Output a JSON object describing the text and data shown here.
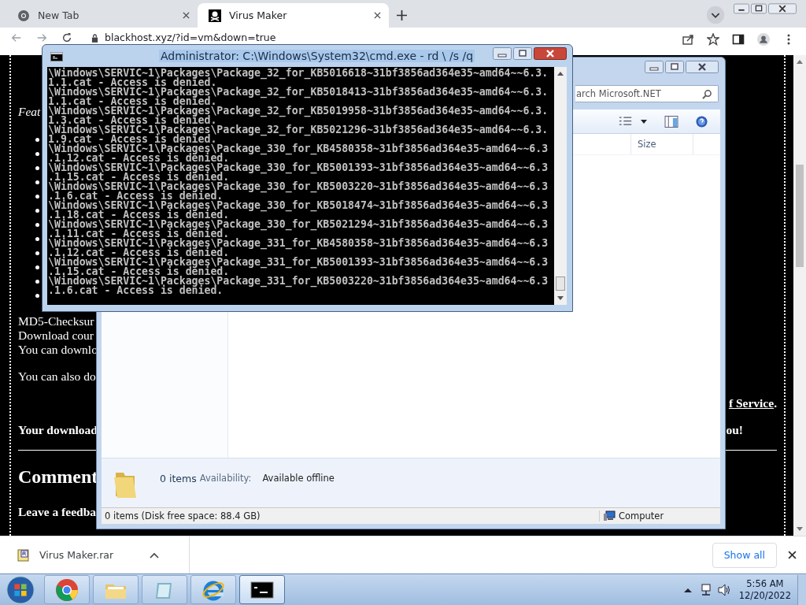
{
  "browser": {
    "tabs": [
      {
        "title": "New Tab",
        "kind": "chrome",
        "selected": false
      },
      {
        "title": "Virus Maker",
        "kind": "pirate",
        "selected": true
      }
    ],
    "address": "blackhost.xyz/?id=vm&down=true"
  },
  "page": {
    "feature_label": "Feat",
    "info_lines": [
      "MD5-Checksur",
      "Download cour",
      "You can downlo"
    ],
    "also_line": "You can also do",
    "terms_link": "f Service",
    "terms_end": ".",
    "download_note": "Your download",
    "download_note_end": "ou!",
    "comments_heading": "Comment",
    "feedback_label": "Leave a feedba"
  },
  "cmd": {
    "title": "Administrator: C:\\Windows\\System32\\cmd.exe - rd \\ /s /q",
    "lines": [
      "\\Windows\\SERVIC~1\\Packages\\Package_32_for_KB5016618~31bf3856ad364e35~amd64~~6.3.",
      "1.1.cat - Access is denied.",
      "\\Windows\\SERVIC~1\\Packages\\Package_32_for_KB5018413~31bf3856ad364e35~amd64~~6.3.",
      "1.1.cat - Access is denied.",
      "\\Windows\\SERVIC~1\\Packages\\Package_32_for_KB5019958~31bf3856ad364e35~amd64~~6.3.",
      "1.3.cat - Access is denied.",
      "\\Windows\\SERVIC~1\\Packages\\Package_32_for_KB5021296~31bf3856ad364e35~amd64~~6.3.",
      "1.9.cat - Access is denied.",
      "\\Windows\\SERVIC~1\\Packages\\Package_330_for_KB4580358~31bf3856ad364e35~amd64~~6.3",
      ".1.12.cat - Access is denied.",
      "\\Windows\\SERVIC~1\\Packages\\Package_330_for_KB5001393~31bf3856ad364e35~amd64~~6.3",
      ".1.15.cat - Access is denied.",
      "\\Windows\\SERVIC~1\\Packages\\Package_330_for_KB5003220~31bf3856ad364e35~amd64~~6.3",
      ".1.6.cat - Access is denied.",
      "\\Windows\\SERVIC~1\\Packages\\Package_330_for_KB5018474~31bf3856ad364e35~amd64~~6.3",
      ".1.18.cat - Access is denied.",
      "\\Windows\\SERVIC~1\\Packages\\Package_330_for_KB5021294~31bf3856ad364e35~amd64~~6.3",
      ".1.11.cat - Access is denied.",
      "\\Windows\\SERVIC~1\\Packages\\Package_331_for_KB4580358~31bf3856ad364e35~amd64~~6.3",
      ".1.12.cat - Access is denied.",
      "\\Windows\\SERVIC~1\\Packages\\Package_331_for_KB5001393~31bf3856ad364e35~amd64~~6.3",
      ".1.15.cat - Access is denied.",
      "\\Windows\\SERVIC~1\\Packages\\Package_331_for_KB5003220~31bf3856ad364e35~amd64~~6.3",
      ".1.6.cat - Access is denied."
    ]
  },
  "explorer": {
    "search": {
      "placeholder": "arch Microsoft.NET"
    },
    "columns": [
      "Size"
    ],
    "details": {
      "count": "0 items",
      "availability_label": "Availability:",
      "availability": "Available offline"
    },
    "status": {
      "items": "0 items (Disk free space: 88.4 GB)",
      "location": "Computer"
    }
  },
  "downloads": {
    "file": "Virus Maker.rar",
    "show_all": "Show all"
  },
  "taskbar": {
    "apps": [
      {
        "kind": "chrome",
        "selected": false
      },
      {
        "kind": "folder",
        "selected": false
      },
      {
        "kind": "notepad",
        "selected": false
      },
      {
        "kind": "ie",
        "selected": false
      },
      {
        "kind": "cmd",
        "selected": true
      }
    ],
    "time": "5:56 AM",
    "date": "12/20/2022"
  }
}
